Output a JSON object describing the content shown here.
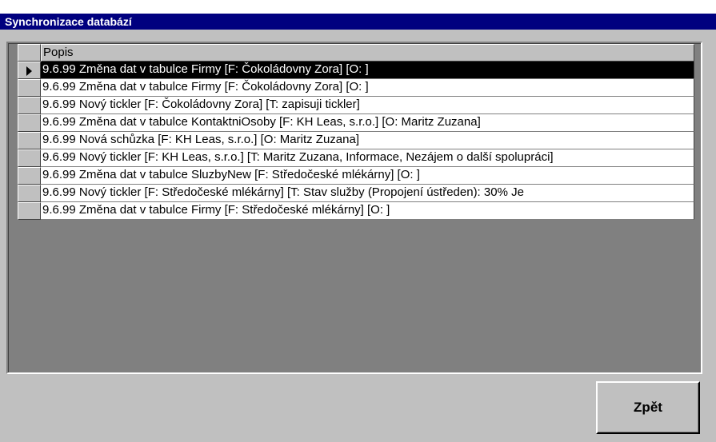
{
  "window": {
    "title": "Synchronizace databází"
  },
  "grid": {
    "column_header": "Popis",
    "selected_row": 0,
    "rows": [
      "9.6.99 Změna dat v tabulce Firmy [F: Čokoládovny Zora] [O: ]",
      "9.6.99 Změna dat v tabulce Firmy [F: Čokoládovny Zora] [O: ]",
      "9.6.99 Nový tickler [F: Čokoládovny Zora] [T: zapisuji tickler]",
      "9.6.99 Změna dat v tabulce KontaktniOsoby [F: KH Leas, s.r.o.] [O: Maritz Zuzana]",
      "9.6.99 Nová schůzka [F: KH Leas, s.r.o.] [O: Maritz Zuzana]",
      "9.6.99 Nový tickler [F: KH Leas, s.r.o.] [T: Maritz Zuzana, Informace, Nezájem o další spolupráci]",
      "9.6.99 Změna dat v tabulce SluzbyNew [F: Středočeské mlékárny] [O: ]",
      "9.6.99 Nový tickler [F: Středočeské mlékárny] [T: Stav služby (Propojení ústředen): 30%  Je",
      "9.6.99 Změna dat v tabulce Firmy [F: Středočeské mlékárny] [O: ]"
    ]
  },
  "buttons": {
    "back_label": "Zpět"
  },
  "colors": {
    "titlebar": "#00007f",
    "face": "#c0c0c0",
    "grid_background": "#808080",
    "selection": "#000000"
  },
  "icons": {
    "current_row": "row-pointer-icon"
  }
}
